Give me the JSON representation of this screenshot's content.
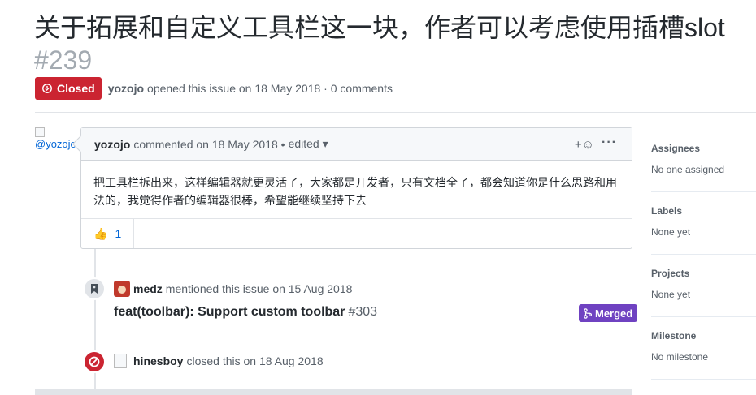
{
  "issue": {
    "title": "关于拓展和自定义工具栏这一块，作者可以考虑使用插槽slot",
    "number": "#239",
    "state": "Closed",
    "author": "yozojo",
    "opened_text": "opened this issue on 18 May 2018 · 0 comments"
  },
  "comment": {
    "avatar_alt": "@yozojo",
    "author": "yozojo",
    "meta": "commented on 18 May 2018 •",
    "edited": "edited ▾",
    "add_reaction": "+☺",
    "more": "···",
    "body": "把工具栏拆出来，这样编辑器就更灵活了，大家都是开发者，只有文档全了，都会知道你是什么思路和用法的，我觉得作者的编辑器很棒，希望能继续坚持下去",
    "reactions": [
      {
        "emoji": "👍",
        "count": "1"
      }
    ]
  },
  "events": {
    "mention": {
      "actor": "medz",
      "text": "mentioned this issue on 15 Aug 2018",
      "ref_title": "feat(toolbar): Support custom toolbar",
      "ref_number": "#303",
      "ref_state": "Merged"
    },
    "closed": {
      "actor": "hinesboy",
      "text": "closed this on 18 Aug 2018"
    }
  },
  "sidebar": {
    "sections": [
      {
        "heading": "Assignees",
        "value": "No one assigned"
      },
      {
        "heading": "Labels",
        "value": "None yet"
      },
      {
        "heading": "Projects",
        "value": "None yet"
      },
      {
        "heading": "Milestone",
        "value": "No milestone"
      }
    ]
  },
  "colors": {
    "closed_red": "#cb2431",
    "merged_purple": "#6f42c1",
    "link_blue": "#0366d6"
  }
}
